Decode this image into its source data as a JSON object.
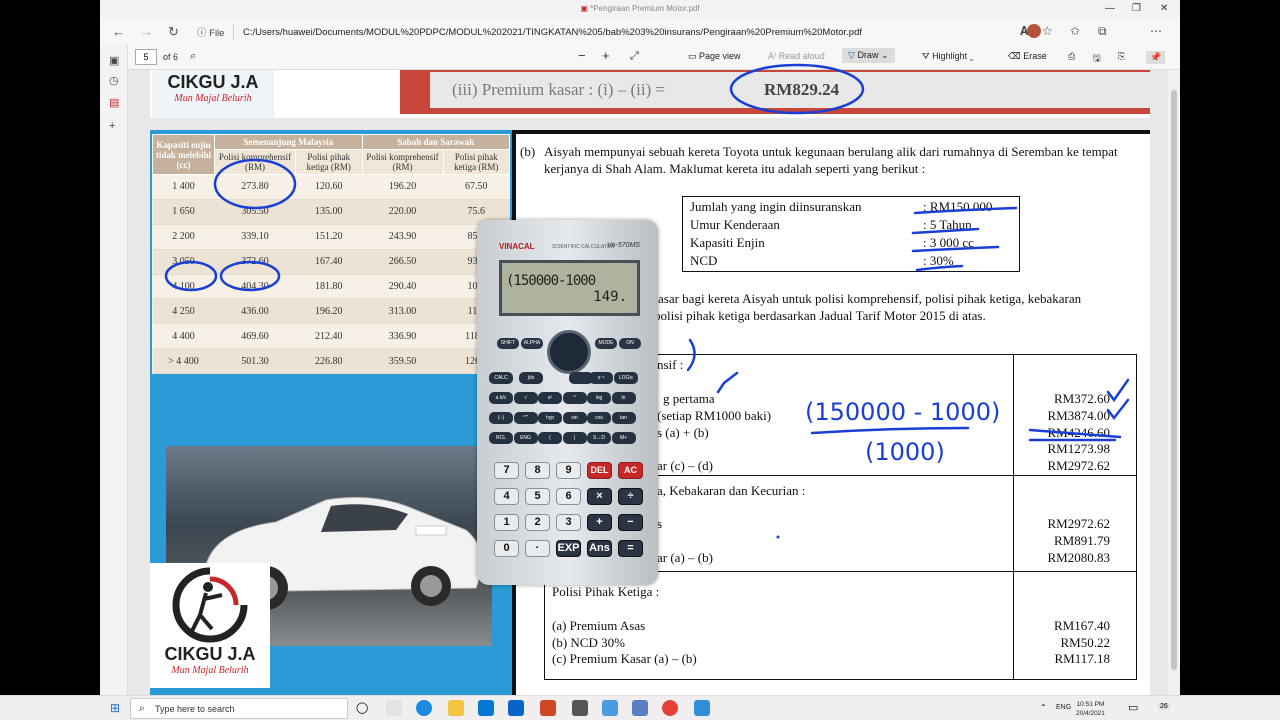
{
  "browser": {
    "tab_title": "*Pengiraan Premium Motor.pdf",
    "file_label": "File",
    "url": "C:/Users/huawei/Documents/MODUL%20PDPC/MODUL%202021/TINGKATAN%205/bab%203%20insurans/Pengiraan%20Premium%20Motor.pdf"
  },
  "pdf_toolbar": {
    "page_number": "5",
    "page_count": "of 6",
    "minus": "−",
    "plus": "+",
    "page_view": "Page view",
    "read_aloud": "Read aloud",
    "draw": "Draw",
    "highlight": "Highlight",
    "erase": "Erase"
  },
  "top_strip": {
    "premium_line": "(iii)   Premium kasar : (i) – (ii)  =",
    "premium_value": "RM829.24",
    "brand_name": "CIKGU J.A",
    "brand_sub": "Mun Majal Belurih"
  },
  "tariff": {
    "headers": [
      "Kapasiti enjin tidak melebihi (cc)",
      "Semenanjung Malaysia",
      "Sabah dan Sarawak"
    ],
    "subheaders": [
      "Polisi komprehensif (RM)",
      "Polisi pihak ketiga (RM)",
      "Polisi komprehensif (RM)",
      "Polisi pihak ketiga (RM)"
    ],
    "rows": [
      [
        "1 400",
        "273.80",
        "120.60",
        "196.20",
        "67.50"
      ],
      [
        "1 650",
        "305.50",
        "135.00",
        "220.00",
        "75.6"
      ],
      [
        "2 200",
        "339.10",
        "151.20",
        "243.90",
        "85.2"
      ],
      [
        "3 050",
        "372.60",
        "167.40",
        "266.50",
        "93.6"
      ],
      [
        "4 100",
        "404.30",
        "181.80",
        "290.40",
        "101."
      ],
      [
        "4 250",
        "436.00",
        "196.20",
        "313.00",
        "110."
      ],
      [
        "4 400",
        "469.60",
        "212.40",
        "336.90",
        "118.2"
      ],
      [
        "> 4 400",
        "501.30",
        "226.80",
        "359.50",
        "126.6"
      ]
    ]
  },
  "brand_bottom": {
    "name": "CIKGU J.A",
    "sub": "Mun Majal Belurih"
  },
  "question": {
    "label": "(b)",
    "text": "Aisyah mempunyai sebuah kereta Toyota untuk kegunaan berulang alik dari rumahnya di Seremban ke tempat kerjanya di Shah Alam. Maklumat kereta itu adalah seperti yang berikut :",
    "info": [
      {
        "k": "Jumlah yang ingin diinsuranskan",
        "v": ": RM150 000"
      },
      {
        "k": "Umur Kenderaan",
        "v": ": 5 Tahun"
      },
      {
        "k": "Kapasiti Enjin",
        "v": ": 3 000 cc"
      },
      {
        "k": "NCD",
        "v": ": 30%"
      }
    ],
    "task_line1": "asar bagi kereta Aisyah untuk polisi komprehensif, polisi pihak ketiga, kebakaran",
    "task_line2": "polisi pihak ketiga berdasarkan Jadual Tarif Motor 2015 di atas."
  },
  "answers": {
    "comp_title": "nsif  :",
    "comp_lines": [
      "g pertama",
      "(setiap RM1000 baki)",
      "s (a) + (b)",
      "",
      "ar (c) – (d)"
    ],
    "comp_amounts": [
      "RM372.60",
      "RM3874.00",
      "RM4246.60",
      "RM1273.98",
      "RM2972.62"
    ],
    "fire_title": "a, Kebakaran dan Kecurian :",
    "fire_lines": [
      "s",
      "",
      "ar (a) – (b)"
    ],
    "fire_amounts": [
      "RM2972.62",
      "RM891.79",
      "RM2080.83"
    ],
    "third_title": "Polisi Pihak Ketiga :",
    "third_lines": [
      "(a)  Premium Asas",
      "(b)  NCD 30%",
      "(c)  Premium Kasar (a) – (b)"
    ],
    "third_amounts": [
      "RM167.40",
      "RM50.22",
      "RM117.18"
    ]
  },
  "handwriting": {
    "fraction_top": "(150000 - 1000)",
    "fraction_bottom": "(1000)"
  },
  "calculator": {
    "brand": "VINACAL",
    "brand_sub": "SCIENTIFIC CALCULATOR",
    "model": "Vn-570MS",
    "expression": "(150000-1000",
    "result": "149.",
    "keys_row1": [
      "7",
      "8",
      "9",
      "DEL",
      "AC"
    ],
    "keys_row2": [
      "4",
      "5",
      "6",
      "×",
      "÷"
    ],
    "keys_row3": [
      "1",
      "2",
      "3",
      "+",
      "−"
    ],
    "keys_row4": [
      "0",
      "·",
      "EXP",
      "Ans",
      "="
    ],
    "fn_row1": [
      "CALC",
      "∫dx",
      "",
      "x⁻¹",
      "LOGic"
    ],
    "fn_row2": [
      "a b/c",
      "√",
      "x²",
      "^",
      "log",
      "ln"
    ],
    "fn_row3": [
      "(−)",
      "°'\"",
      "hyp",
      "sin",
      "cos",
      "tan"
    ],
    "fn_row4": [
      "RCL",
      "ENG",
      "(",
      ")",
      "S↔D",
      "M+"
    ]
  },
  "taskbar": {
    "search_placeholder": "Type here to search",
    "time": "10:51 PM",
    "date": "20/4/2021",
    "lang": "ENG",
    "notif": "26"
  }
}
